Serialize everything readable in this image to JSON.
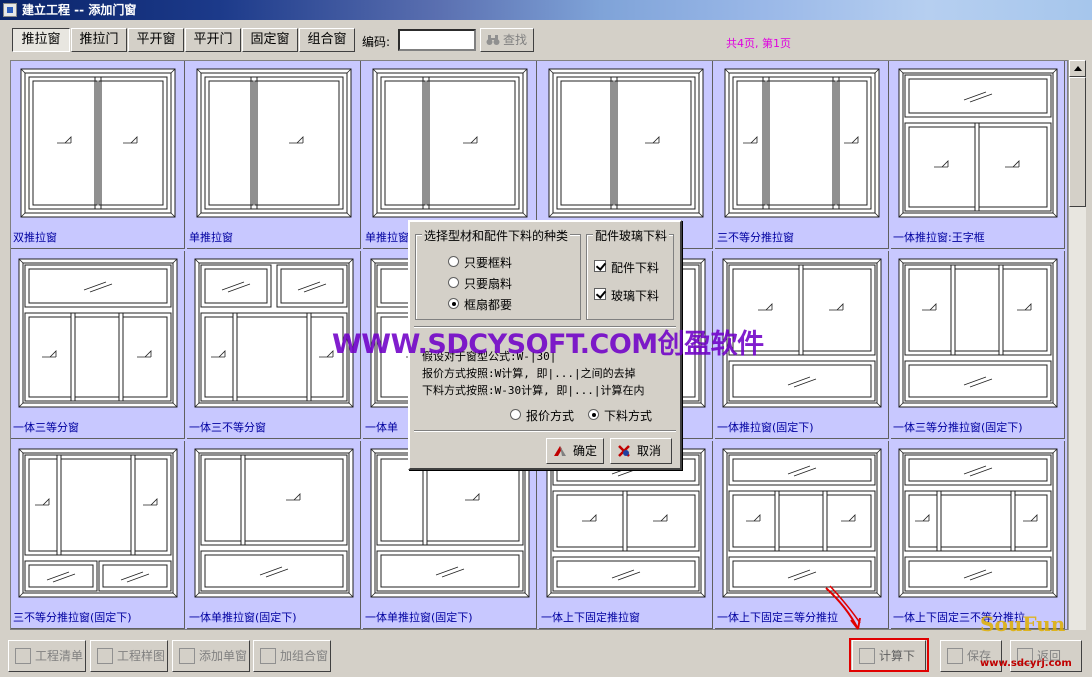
{
  "window": {
    "title": "建立工程 -- 添加门窗"
  },
  "toolbar": {
    "tabs": [
      {
        "label": "推拉窗",
        "active": true
      },
      {
        "label": "推拉门",
        "active": false
      },
      {
        "label": "平开窗",
        "active": false
      },
      {
        "label": "平开门",
        "active": false
      },
      {
        "label": "固定窗",
        "active": false
      },
      {
        "label": "组合窗",
        "active": false
      }
    ],
    "code_label": "编码:",
    "code_value": "",
    "search_label": "查找",
    "search_icon": "binoculars-icon",
    "page_info": "共4页, 第1页"
  },
  "gallery": {
    "items": [
      {
        "caption": "双推拉窗"
      },
      {
        "caption": "单推拉窗"
      },
      {
        "caption": "单推拉窗"
      },
      {
        "caption": ""
      },
      {
        "caption": "三不等分推拉窗"
      },
      {
        "caption": "一体推拉窗:王字框"
      },
      {
        "caption": "一体三等分窗"
      },
      {
        "caption": "一体三不等分窗"
      },
      {
        "caption": "一体单"
      },
      {
        "caption": ""
      },
      {
        "caption": "一体推拉窗(固定下)"
      },
      {
        "caption": "一体三等分推拉窗(固定下)"
      },
      {
        "caption": "三不等分推拉窗(固定下)"
      },
      {
        "caption": "一体单推拉窗(固定下)"
      },
      {
        "caption": "一体单推拉窗(固定下)"
      },
      {
        "caption": "一体上下固定推拉窗"
      },
      {
        "caption": "一体上下固定三等分推拉"
      },
      {
        "caption": "一体上下固定三不等分推拉"
      }
    ]
  },
  "dialog": {
    "material_group_title": "选择型材和配件下料的种类",
    "options": [
      {
        "label": "只要框料",
        "selected": false
      },
      {
        "label": "只要扇料",
        "selected": false
      },
      {
        "label": "框扇都要",
        "selected": true
      }
    ],
    "glass_group_title": "配件玻璃下料",
    "checks": [
      {
        "label": "配件下料",
        "checked": true
      },
      {
        "label": "玻璃下料",
        "checked": true
      }
    ],
    "formula_lines": [
      "假设对于窗型公式:W-|30|",
      "报价方式按照:W计算, 即|...|之间的去掉",
      "下料方式按照:W-30计算, 即|...|计算在内"
    ],
    "mode_options": [
      {
        "label": "报价方式",
        "selected": false
      },
      {
        "label": "下料方式",
        "selected": true
      }
    ],
    "ok_label": "确定",
    "cancel_label": "取消"
  },
  "bottombar": {
    "buttons": [
      {
        "label": "工程清单",
        "icon": "list-icon"
      },
      {
        "label": "工程样图",
        "icon": "image-icon"
      },
      {
        "label": "添加单窗",
        "icon": "window-add-icon"
      },
      {
        "label": "加组合窗",
        "icon": "combo-window-icon"
      },
      {
        "label": "计算下料",
        "icon": "calculate-icon"
      },
      {
        "label": "保存",
        "icon": "save-icon"
      },
      {
        "label": "返回",
        "icon": "return-icon"
      }
    ]
  },
  "overlays": {
    "watermark": "WWW.SDCYSOFT.COM创盈软件",
    "soufun_logo": "SouFun",
    "site_watermark": "www.sdcyrj.com"
  },
  "colors": {
    "gallery_bg": "#c8c8ff",
    "caption": "#0000a0",
    "page_info": "#e000e0",
    "watermark": "#7000c8",
    "highlight": "#e00000"
  }
}
